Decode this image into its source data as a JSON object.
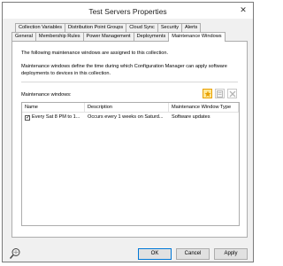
{
  "window": {
    "title": "Test Servers Properties",
    "close_glyph": "✕"
  },
  "tabs_row1": [
    "Collection Variables",
    "Distribution Point Groups",
    "Cloud Sync",
    "Security",
    "Alerts"
  ],
  "tabs_row2": [
    "General",
    "Membership Rules",
    "Power Management",
    "Deployments",
    "Maintenance Windows"
  ],
  "active_tab": "Maintenance Windows",
  "panel": {
    "description": "The following maintenance windows are assigned to this collection.",
    "info": "Maintenance windows define the time during which Configuration Manager can apply software deployments to devices in this collection.",
    "mw_label": "Maintenance windows:"
  },
  "toolbar_icons": [
    "new-star-icon",
    "properties-icon",
    "delete-icon"
  ],
  "list": {
    "columns": [
      "Name",
      "Description",
      "Maintenance Window Type"
    ],
    "rows": [
      {
        "checked": true,
        "name": "Every Sat 8 PM to 1...",
        "description": "Occurs every 1 weeks on Saturd...",
        "type": "Software updates"
      }
    ]
  },
  "buttons": {
    "ok": "OK",
    "cancel": "Cancel",
    "apply": "Apply"
  },
  "colors": {
    "accent": "#0078d7",
    "new_button": "#ffe89a"
  }
}
